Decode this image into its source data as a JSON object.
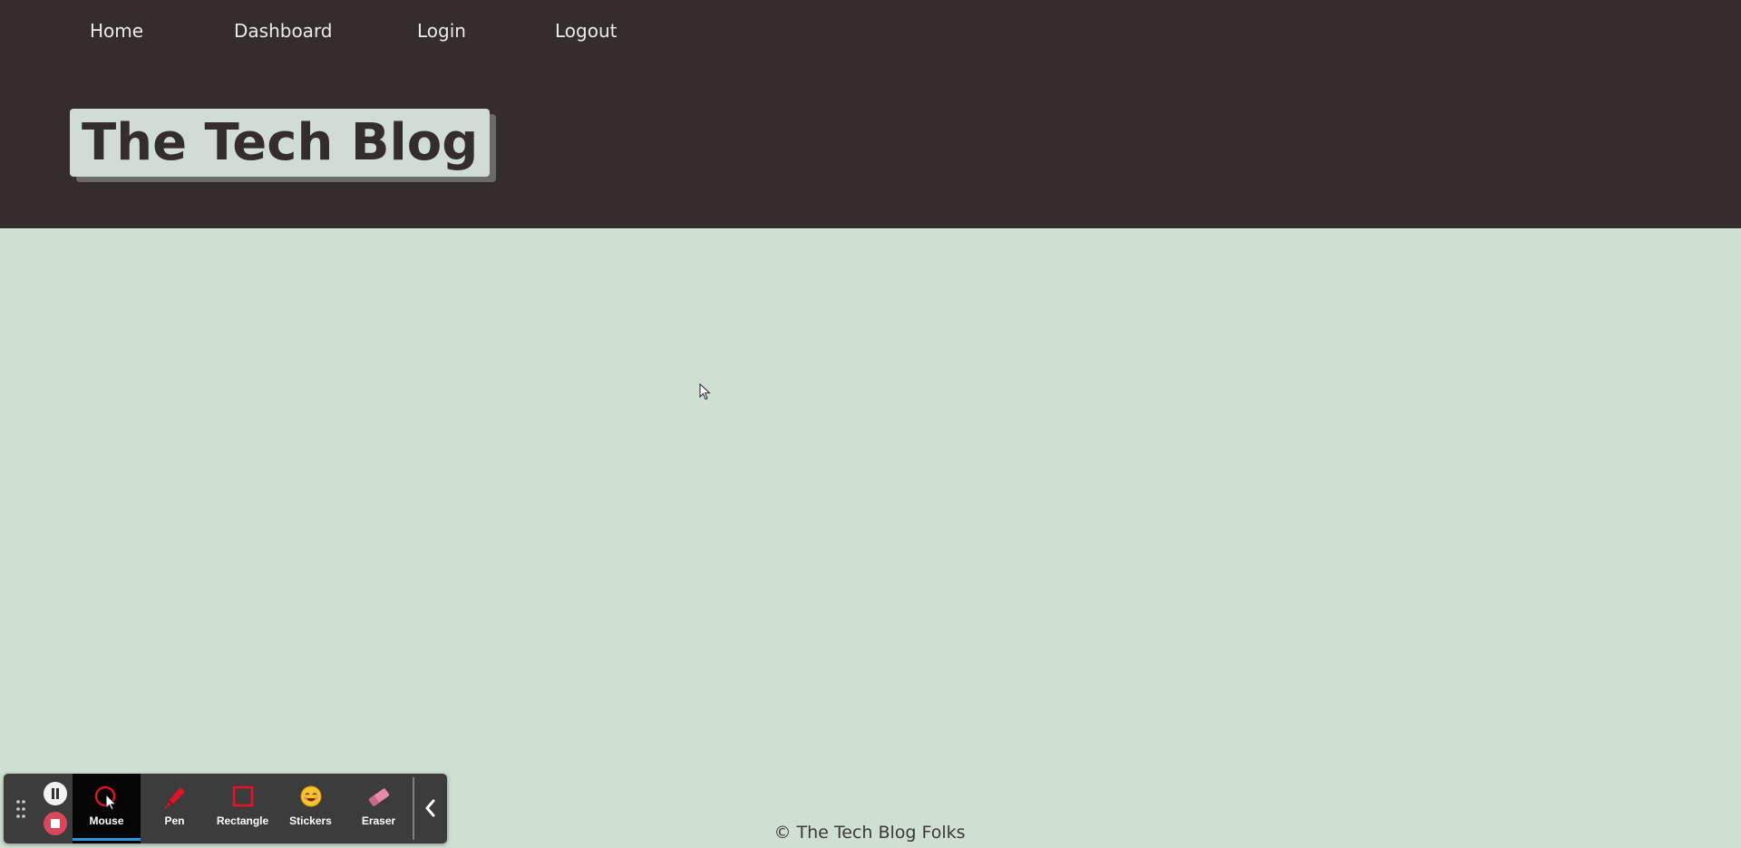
{
  "nav": {
    "items": [
      {
        "label": "Home"
      },
      {
        "label": "Dashboard"
      },
      {
        "label": "Login"
      },
      {
        "label": "Logout"
      }
    ]
  },
  "header": {
    "title": "The Tech Blog"
  },
  "footer": {
    "text": "© The Tech Blog Folks"
  },
  "recorder_toolbar": {
    "controls": [
      {
        "icon": "pause-icon"
      },
      {
        "icon": "stop-icon"
      }
    ],
    "tools": [
      {
        "label": "Mouse",
        "icon": "mouse-cursor-icon",
        "active": true
      },
      {
        "label": "Pen",
        "icon": "pen-icon",
        "active": false
      },
      {
        "label": "Rectangle",
        "icon": "rectangle-icon",
        "active": false
      },
      {
        "label": "Stickers",
        "icon": "sticker-icon",
        "active": false
      },
      {
        "label": "Eraser",
        "icon": "eraser-icon",
        "active": false
      }
    ],
    "collapse_icon": "chevron-left-icon"
  },
  "colors": {
    "header_bg": "#352d2d",
    "page_bg": "#cfdfd2",
    "title_box_bg": "#d1ddd4",
    "nav_text": "#e9ece9",
    "toolbar_bg": "#3c3c3c",
    "active_underline": "#2d97e0",
    "stop_red": "#d9475a",
    "tool_red": "#e0132b"
  }
}
